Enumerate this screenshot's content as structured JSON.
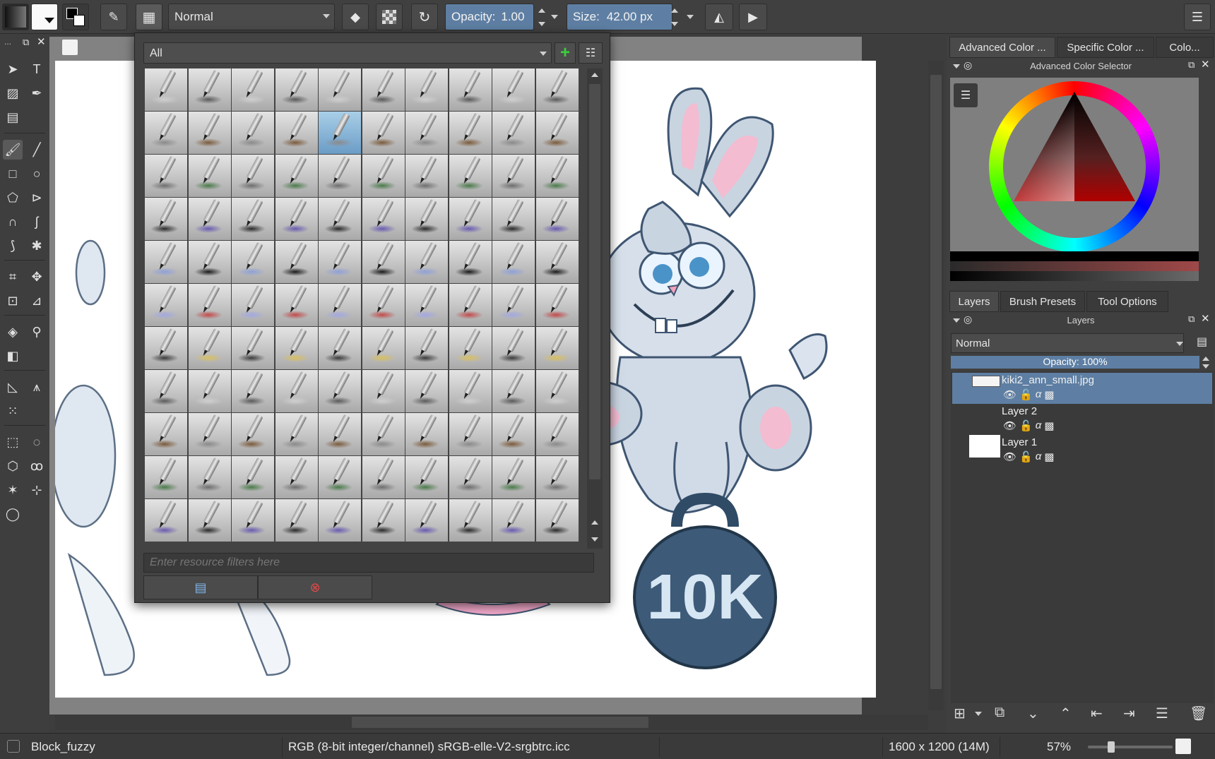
{
  "toolbar": {
    "blend_mode": "Normal",
    "opacity_label": "Opacity:",
    "opacity_value": "1.00",
    "size_label": "Size:",
    "size_value": "42.00 px"
  },
  "brush_popup": {
    "filter_tag": "All",
    "filter_placeholder": "Enter resource filters here",
    "grid_rows": 11,
    "grid_cols": 10,
    "selected_index": 14
  },
  "dock": {
    "color_tabs": [
      "Advanced Color ...",
      "Specific Color ...",
      "Colo..."
    ],
    "color_panel_title": "Advanced Color Selector",
    "layer_tabs": [
      "Layers",
      "Brush Presets",
      "Tool Options"
    ],
    "layers_panel_title": "Layers",
    "layer_blend": "Normal",
    "layer_opacity": "Opacity:  100%",
    "layers": [
      {
        "name": "kiki2_ann_small.jpg",
        "selected": true
      },
      {
        "name": "Layer 2",
        "selected": false
      },
      {
        "name": "Layer 1",
        "selected": false
      }
    ]
  },
  "status": {
    "brush_name": "Block_fuzzy",
    "color_space": "RGB (8-bit integer/channel)  sRGB-elle-V2-srgbtrc.icc",
    "image_size": "1600 x 1200 (14M)",
    "zoom": "57%"
  },
  "artwork": {
    "kettlebell_text": "10K"
  },
  "colors": {
    "selection_blue": "#5e7fa3",
    "panel_bg": "#3d3d3d",
    "canvas_bg": "#828282"
  }
}
